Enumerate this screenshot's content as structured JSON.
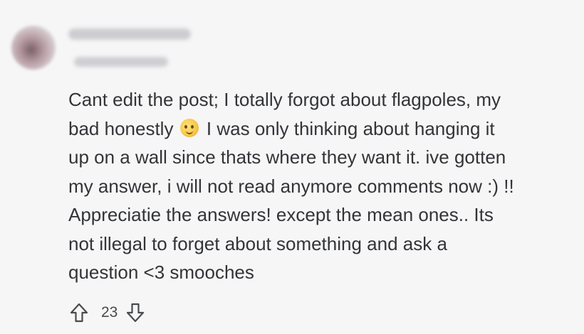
{
  "comment": {
    "lines": [
      "Cant edit the post; I totally forgot about flagpoles, my",
      "bad honestly",
      " I was only thinking about hanging it",
      "up on a wall since thats where they want it. ive gotten",
      "my answer, i will not read anymore comments now :) !!",
      "Appreciatie the answers! except the mean ones.. Its",
      "not illegal to forget about something and ask a",
      "question <3 smooches"
    ],
    "emoji": "melting-face-emoji"
  },
  "votes": {
    "count": "23",
    "upvote_icon": "upvote-arrow-icon",
    "downvote_icon": "downvote-arrow-icon"
  },
  "colors": {
    "background": "#f6f6f7",
    "text": "#333437",
    "icon": "#4a4b4e"
  }
}
